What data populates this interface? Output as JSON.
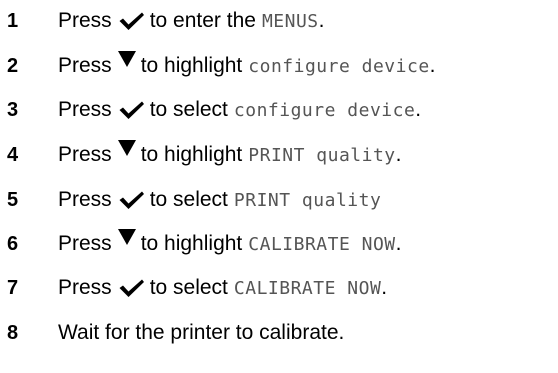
{
  "steps": [
    {
      "num": "1",
      "pre": "Press",
      "icon": "checkmark-icon",
      "mid": "to enter the",
      "lcd": "MENUS",
      "post": "."
    },
    {
      "num": "2",
      "pre": "Press",
      "icon": "down-arrow-icon",
      "mid": "to highlight",
      "lcd": "configure device",
      "post": "."
    },
    {
      "num": "3",
      "pre": "Press",
      "icon": "checkmark-icon",
      "mid": "to select",
      "lcd": "configure device",
      "post": "."
    },
    {
      "num": "4",
      "pre": "Press",
      "icon": "down-arrow-icon",
      "mid": "to highlight",
      "lcd": "PRINT quality",
      "post": "."
    },
    {
      "num": "5",
      "pre": "Press",
      "icon": "checkmark-icon",
      "mid": "to select",
      "lcd": "PRINT quality",
      "post": ""
    },
    {
      "num": "6",
      "pre": "Press",
      "icon": "down-arrow-icon",
      "mid": "to highlight",
      "lcd": "CALIBRATE NOW",
      "post": "."
    },
    {
      "num": "7",
      "pre": "Press",
      "icon": "checkmark-icon",
      "mid": "to select",
      "lcd": "CALIBRATE NOW",
      "post": "."
    },
    {
      "num": "8",
      "text": "Wait for the printer to calibrate."
    }
  ]
}
